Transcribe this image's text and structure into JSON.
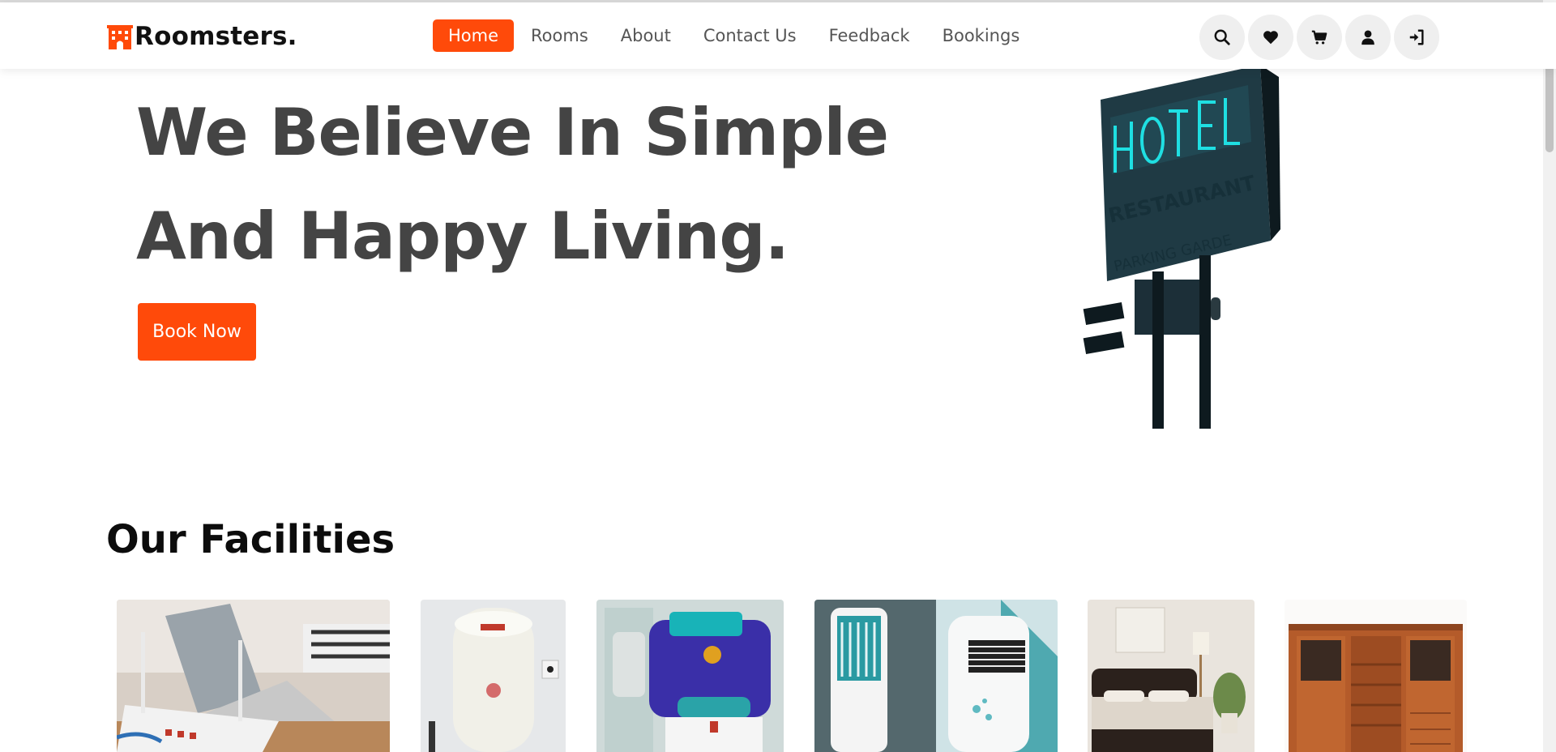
{
  "brand": {
    "name": "Roomsters.",
    "accent": "#ff4a0a"
  },
  "nav": {
    "items": [
      {
        "label": "Home",
        "active": true
      },
      {
        "label": "Rooms"
      },
      {
        "label": "About"
      },
      {
        "label": "Contact Us"
      },
      {
        "label": "Feedback"
      },
      {
        "label": "Bookings"
      }
    ],
    "icons": [
      "search-icon",
      "heart-icon",
      "cart-icon",
      "user-icon",
      "login-icon"
    ]
  },
  "hero": {
    "line1": "We Believe In Simple",
    "line2": "And Happy Living.",
    "cta": "Book Now",
    "image": "hotel-restaurant-sign-image"
  },
  "facilities": {
    "title": "Our Facilities",
    "items": [
      "wifi-router-image",
      "water-heater-image",
      "water-purifier-image",
      "air-cooler-image",
      "bed-image",
      "wardrobe-image"
    ]
  }
}
